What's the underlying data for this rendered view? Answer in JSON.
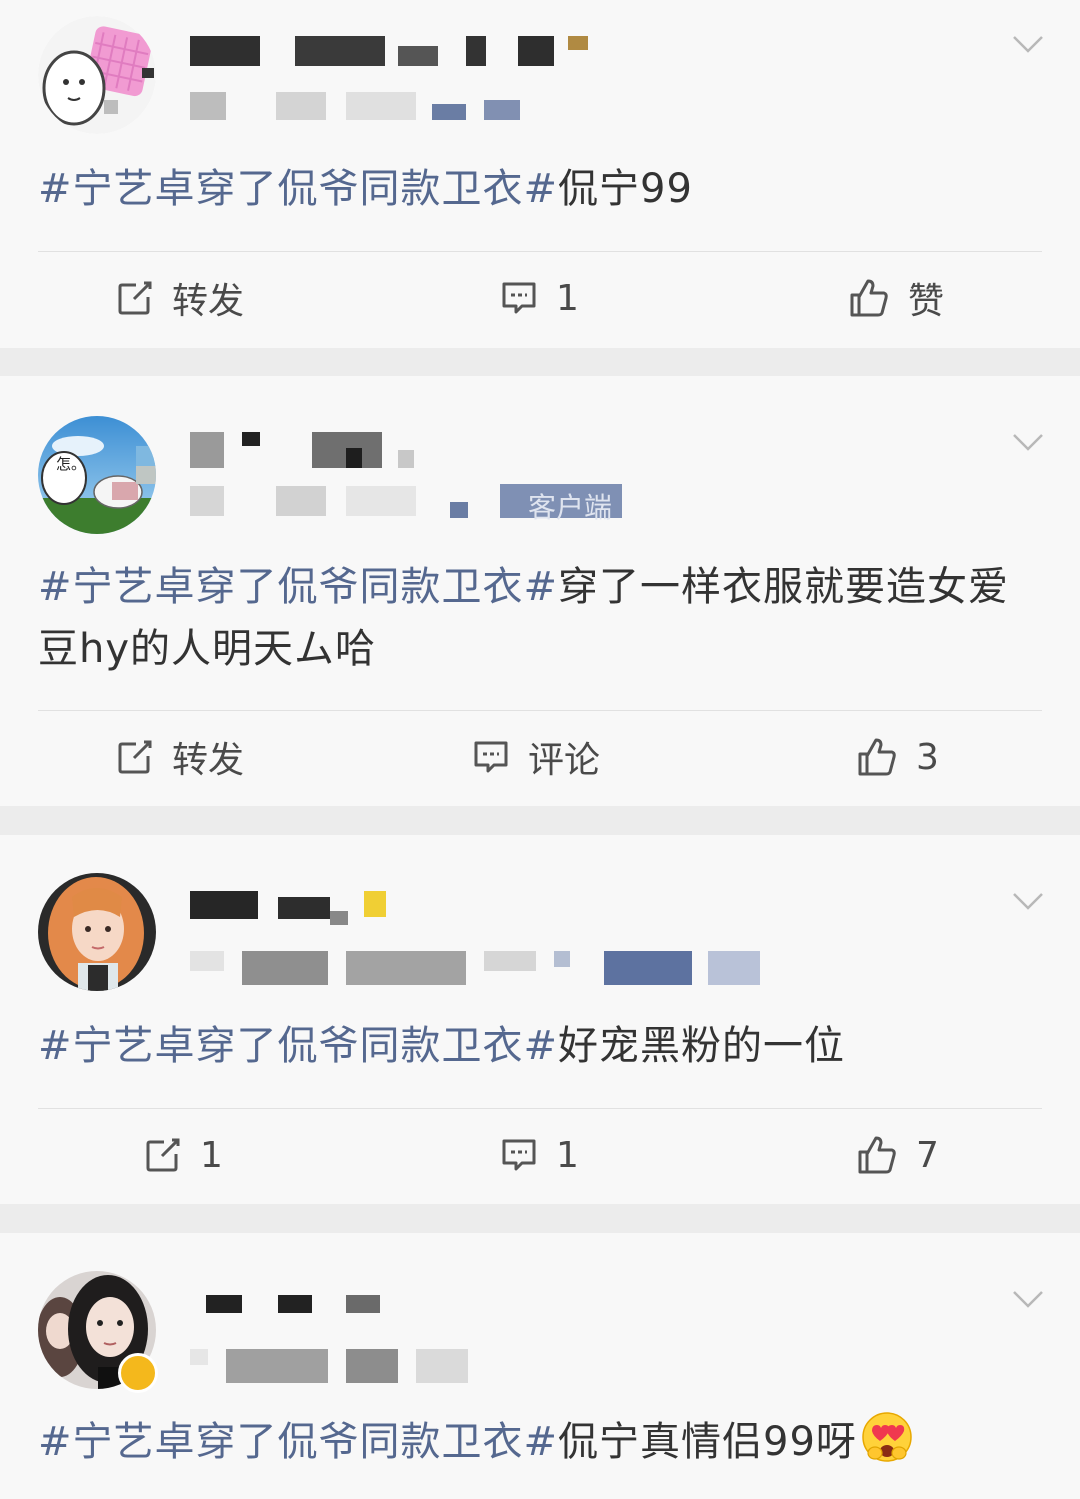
{
  "posts": [
    {
      "tag": "#宁艺卓穿了侃爷同款卫衣#",
      "text": "侃宁99",
      "actions": {
        "repost": "转发",
        "comment": "1",
        "like": "赞"
      }
    },
    {
      "tag": "#宁艺卓穿了侃爷同款卫衣#",
      "text": "穿了一样衣服就要造女爱豆hy的人明天ム哈",
      "meta_fragment": "客户端",
      "actions": {
        "repost": "转发",
        "comment": "评论",
        "like": "3"
      }
    },
    {
      "tag": "#宁艺卓穿了侃爷同款卫衣#",
      "text": "好宠黑粉的一位",
      "actions": {
        "repost": "1",
        "comment": "1",
        "like": "7"
      }
    },
    {
      "tag": "#宁艺卓穿了侃爷同款卫衣#",
      "text": "侃宁真情侣99呀",
      "emoji": "heart-eyes-emoji"
    }
  ],
  "avatar_text": "怎。",
  "colors": {
    "hashtag": "#55688f",
    "text": "#333333",
    "background": "#f8f8f8",
    "separator": "#ececec"
  },
  "icons": [
    "repost-icon",
    "comment-icon",
    "like-icon",
    "chevron-down-icon"
  ]
}
